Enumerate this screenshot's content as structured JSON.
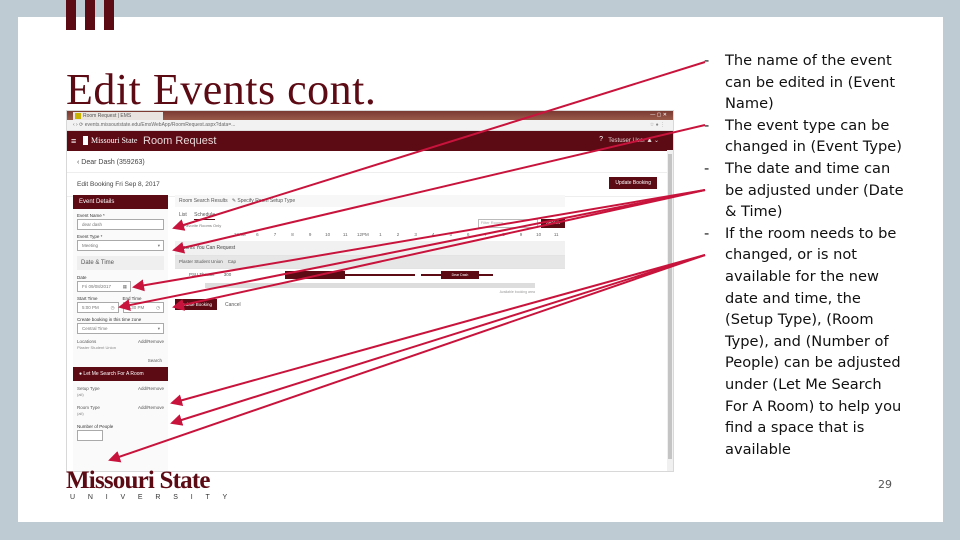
{
  "slide": {
    "title": "Edit Events cont.",
    "page_number": "29",
    "accent_color": "#5c0a14",
    "annotation_color": "#c8143c"
  },
  "browser": {
    "tab_title": "Room Request | EMS",
    "address": "events.missouristate.edu/EmsWebApp/RoomRequest.aspx?data=...",
    "app_header": {
      "menu_icon": "hamburger-icon",
      "logo_text": "Missouri State",
      "app_title": "Room Request",
      "help_icon": "help-icon",
      "user_label": "Testuser User",
      "user_icon": "user-icon"
    },
    "breadcrumb": "Dear Dash (359263)",
    "edit_title": "Edit Booking Fri Sep 8, 2017",
    "update_booking_top": "Update Booking",
    "left_panel": {
      "header": "Event Details",
      "event_name_label": "Event Name *",
      "event_name_value": "dear dash",
      "event_type_label": "Event Type *",
      "event_type_value": "Meeting",
      "date_time_header": "Date & Time",
      "date_label": "Date",
      "date_value": "Fri 09/08/2017",
      "start_time_label": "Start Time",
      "start_time_value": "5:00 PM",
      "end_time_label": "End Time",
      "end_time_value": "5:30 PM",
      "timezone_label": "Create booking in this time zone",
      "timezone_value": "Central Time",
      "locations_label": "Locations",
      "locations_action": "Add/Remove",
      "locations_value": "Plaster Student Union",
      "search_label": "Search",
      "let_me_search_header": "Let Me Search For A Room",
      "setup_type_label": "Setup Type",
      "setup_type_action": "Add/Remove",
      "setup_type_value": "(all)",
      "room_type_label": "Room Type",
      "room_type_action": "Add/Remove",
      "room_type_value": "(all)",
      "people_label": "Number of People",
      "people_value": ""
    },
    "right_panel": {
      "toolbar_text": "Room Search Results",
      "toolbar_action": "Specify Room Setup Type",
      "tabs": [
        "List",
        "Schedule"
      ],
      "active_tab": "Schedule",
      "checkbox_label": "Favorite Rooms Only",
      "search_placeholder": "Filter Rooms",
      "search_button": "Search",
      "hours": [
        "12AM",
        "6",
        "7",
        "8",
        "9",
        "10",
        "11",
        "12PM",
        "1",
        "2",
        "3",
        "4",
        "5",
        "6",
        "7",
        "8",
        "9",
        "10",
        "11"
      ],
      "grid_header": "Rooms You Can Request",
      "grid_rows": [
        {
          "room": "Plaster Student Union",
          "cap": "Cap"
        },
        {
          "room": "PSU Theater",
          "cap": "300",
          "booking_label": "Dear Dash"
        }
      ],
      "availability_note": "Available booking area",
      "update_booking": "Update Booking",
      "cancel": "Cancel"
    }
  },
  "bullets": [
    "The name of the event can be edited in (Event Name)",
    "The event type can be changed in (Event Type)",
    "The date and time can be adjusted under (Date & Time)",
    "If the room needs to be changed, or is not available for the new date and time, the (Setup Type), (Room Type), and (Number of People) can be adjusted under (Let Me Search For A Room) to help you find a space that is available"
  ],
  "bullet_marker": "-",
  "logo": {
    "wordmark": "Missouri State",
    "subtitle": "UNIVERSITY"
  }
}
